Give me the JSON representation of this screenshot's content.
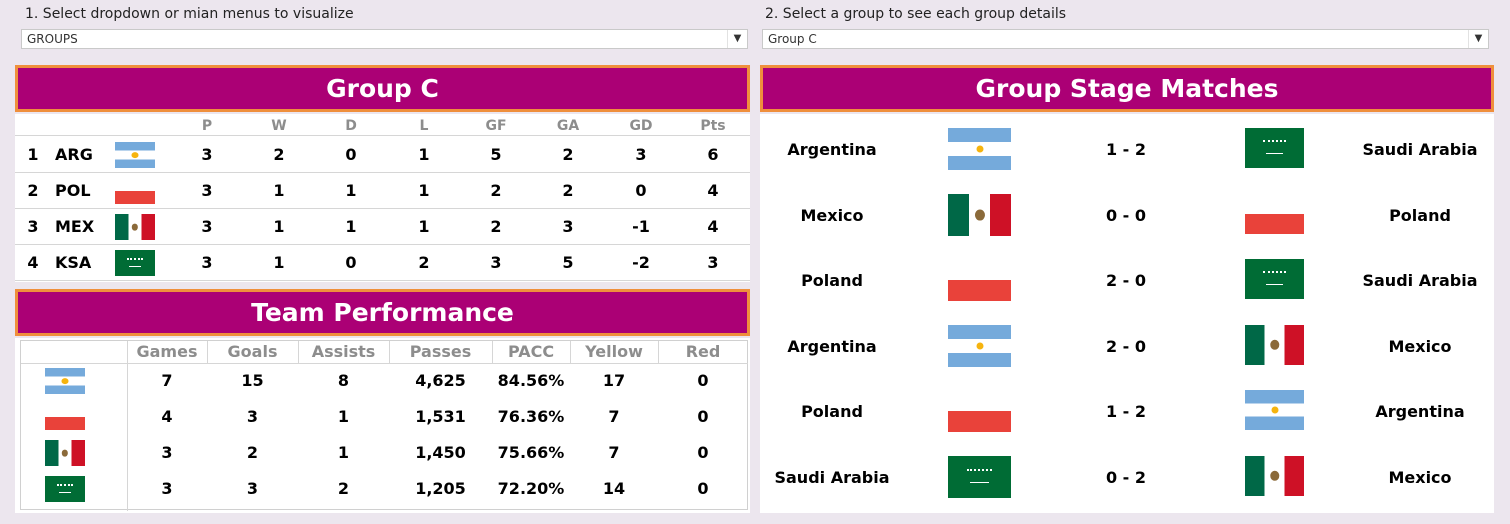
{
  "controls": {
    "menu_label": "1. Select dropdown or mian menus to visualize",
    "menu_value": "GROUPS",
    "group_label": "2. Select a group to see each group details",
    "group_value": "Group C"
  },
  "standings": {
    "title": "Group C",
    "headers": [
      "P",
      "W",
      "D",
      "L",
      "GF",
      "GA",
      "GD",
      "Pts"
    ],
    "rows": [
      {
        "rank": "1",
        "team": "ARG",
        "flag": "argentina-flag",
        "P": "3",
        "W": "2",
        "D": "0",
        "L": "1",
        "GF": "5",
        "GA": "2",
        "GD": "3",
        "Pts": "6"
      },
      {
        "rank": "2",
        "team": "POL",
        "flag": "poland-flag",
        "P": "3",
        "W": "1",
        "D": "1",
        "L": "1",
        "GF": "2",
        "GA": "2",
        "GD": "0",
        "Pts": "4"
      },
      {
        "rank": "3",
        "team": "MEX",
        "flag": "mexico-flag",
        "P": "3",
        "W": "1",
        "D": "1",
        "L": "1",
        "GF": "2",
        "GA": "3",
        "GD": "-1",
        "Pts": "4"
      },
      {
        "rank": "4",
        "team": "KSA",
        "flag": "saudi-arabia-flag",
        "P": "3",
        "W": "1",
        "D": "0",
        "L": "2",
        "GF": "3",
        "GA": "5",
        "GD": "-2",
        "Pts": "3"
      }
    ]
  },
  "performance": {
    "title": "Team Performance",
    "headers": [
      "Games",
      "Goals",
      "Assists",
      "Passes",
      "PACC",
      "Yellow",
      "Red"
    ],
    "rows": [
      {
        "flag": "argentina-flag",
        "Games": "7",
        "Goals": "15",
        "Assists": "8",
        "Passes": "4,625",
        "PACC": "84.56%",
        "Yellow": "17",
        "Red": "0"
      },
      {
        "flag": "poland-flag",
        "Games": "4",
        "Goals": "3",
        "Assists": "1",
        "Passes": "1,531",
        "PACC": "76.36%",
        "Yellow": "7",
        "Red": "0"
      },
      {
        "flag": "mexico-flag",
        "Games": "3",
        "Goals": "2",
        "Assists": "1",
        "Passes": "1,450",
        "PACC": "75.66%",
        "Yellow": "7",
        "Red": "0"
      },
      {
        "flag": "saudi-arabia-flag",
        "Games": "3",
        "Goals": "3",
        "Assists": "2",
        "Passes": "1,205",
        "PACC": "72.20%",
        "Yellow": "14",
        "Red": "0"
      }
    ]
  },
  "matches": {
    "title": "Group Stage Matches",
    "rows": [
      {
        "home": "Argentina",
        "home_flag": "argentina-flag",
        "score": "1 - 2",
        "away": "Saudi Arabia",
        "away_flag": "saudi-arabia-flag"
      },
      {
        "home": "Mexico",
        "home_flag": "mexico-flag",
        "score": "0 - 0",
        "away": "Poland",
        "away_flag": "poland-flag"
      },
      {
        "home": "Poland",
        "home_flag": "poland-flag",
        "score": "2 - 0",
        "away": "Saudi Arabia",
        "away_flag": "saudi-arabia-flag"
      },
      {
        "home": "Argentina",
        "home_flag": "argentina-flag",
        "score": "2 - 0",
        "away": "Mexico",
        "away_flag": "mexico-flag"
      },
      {
        "home": "Poland",
        "home_flag": "poland-flag",
        "score": "1 - 2",
        "away": "Argentina",
        "away_flag": "argentina-flag"
      },
      {
        "home": "Saudi Arabia",
        "home_flag": "saudi-arabia-flag",
        "score": "0 - 2",
        "away": "Mexico",
        "away_flag": "mexico-flag"
      }
    ]
  },
  "colors": {
    "banner_bg": "#ab0075",
    "banner_border": "#ef8f3c",
    "page_bg": "#ece6ee"
  }
}
